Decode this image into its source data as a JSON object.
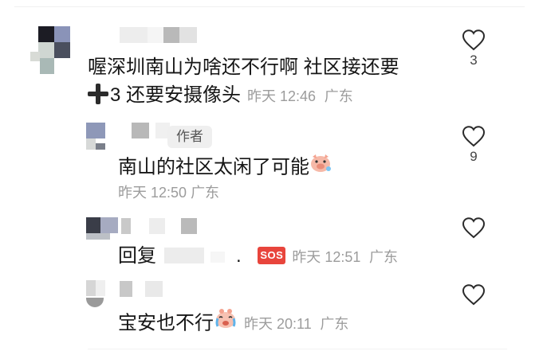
{
  "comments": [
    {
      "text_line1": "喔深圳南山为啥还不行啊 社区接还要",
      "text_line2": "3 还要安摄像头",
      "time": "昨天 12:46",
      "location": "广东",
      "likes": "3",
      "icons": [
        "plus-emoji-icon",
        "heart-icon"
      ]
    },
    {
      "tag": "作者",
      "text": "南山的社区太闲了可能",
      "time": "昨天 12:50",
      "location": "广东",
      "likes": "9",
      "icons": [
        "pig-face-emoji-icon",
        "heart-icon"
      ]
    },
    {
      "reply_prefix": "回复",
      "reply_dot": ".",
      "sos_label": "SOS",
      "time": "昨天 12:51",
      "location": "广东",
      "icons": [
        "sos-emoji-icon",
        "heart-icon"
      ]
    },
    {
      "text": "宝安也不行",
      "time": "昨天 20:11",
      "location": "广东",
      "icons": [
        "crying-face-emoji-icon",
        "heart-icon"
      ]
    }
  ]
}
